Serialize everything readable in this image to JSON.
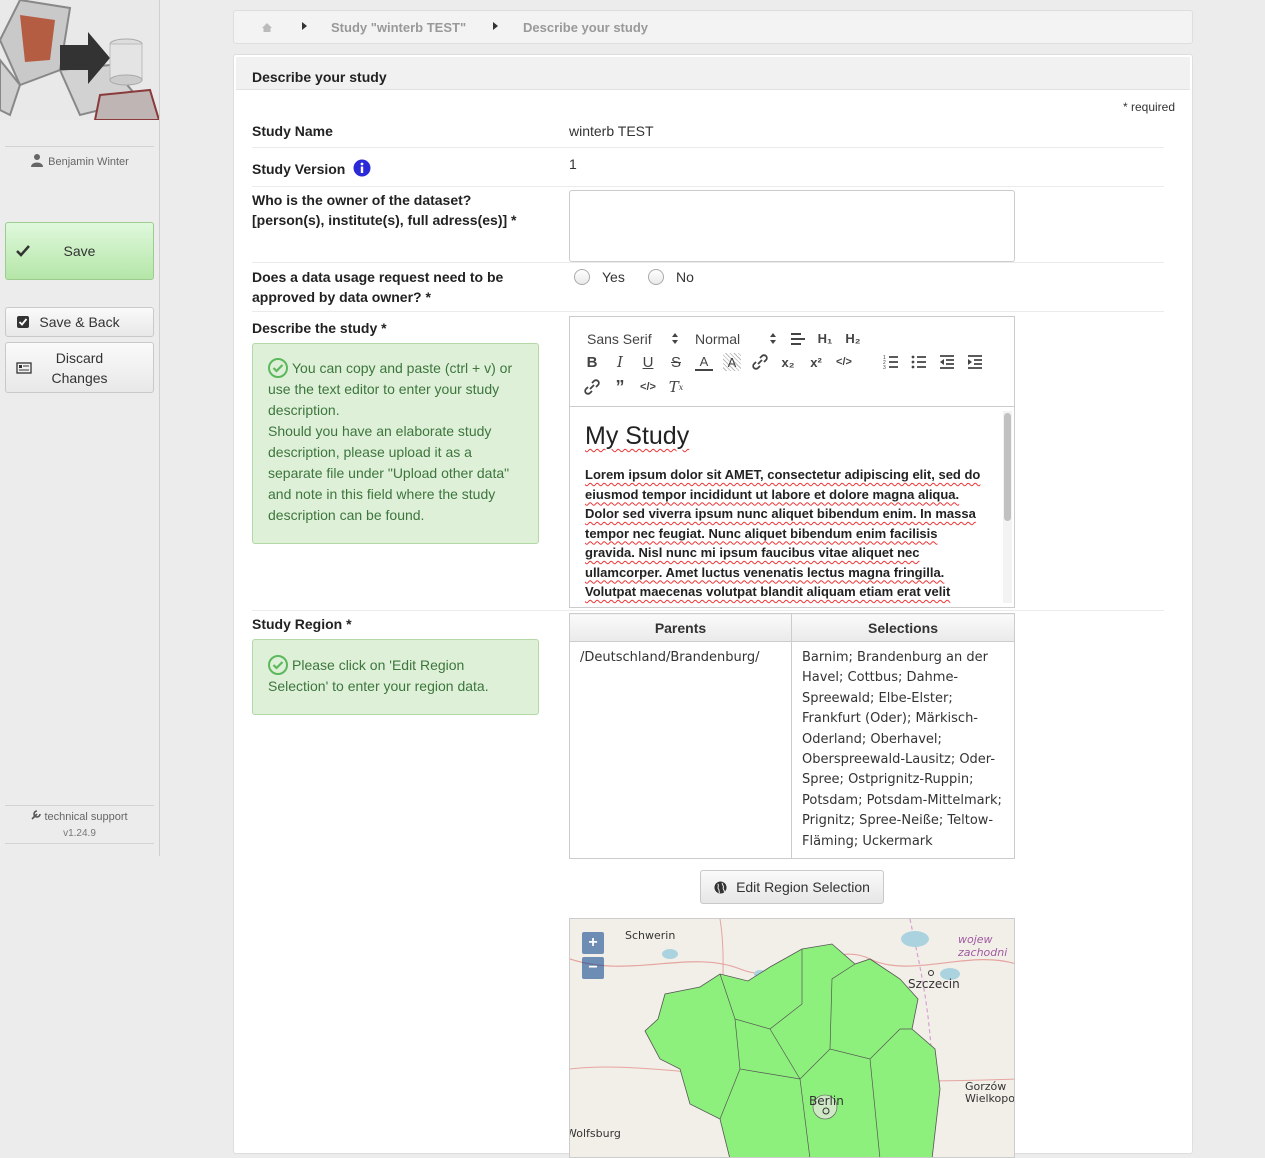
{
  "sidebar": {
    "user_name": "Benjamin Winter",
    "save_label": "Save",
    "save_back_label": "Save & Back",
    "discard_label": "Discard Changes",
    "support_label": "technical support",
    "version": "v1.24.9"
  },
  "breadcrumb": {
    "items": [
      "Study \"winterb TEST\"",
      "Describe your study"
    ]
  },
  "panel": {
    "title": "Describe your study",
    "required_note": "* required",
    "fields": {
      "study_name_label": "Study Name",
      "study_name_value": "winterb TEST",
      "study_version_label": "Study Version",
      "study_version_value": "1",
      "owner_label_line1": "Who is the owner of the dataset?",
      "owner_label_line2": "[person(s), institute(s), full adress(es)] *",
      "owner_value": "",
      "approval_label_line1": "Does a data usage request need to be",
      "approval_label_line2": "approved by data owner? *",
      "approval_options": [
        "Yes",
        "No"
      ],
      "describe_label": "Describe the study *",
      "describe_hint_line1": "You can copy and paste (ctrl + v) or use the text editor to enter your study description.",
      "describe_hint_line2": "Should you have an elaborate study description, please upload it as a separate file under \"Upload other data\" and note in this field where the study description can be found.",
      "region_label": "Study Region *",
      "region_hint": "Please click on 'Edit Region Selection' to enter your region data."
    },
    "editor": {
      "font_select": "Sans Serif",
      "size_select": "Normal",
      "content_title": "My Study",
      "content_text": "Lorem ipsum dolor sit AMET, consectetur adipiscing elit, sed do eiusmod tempor incididunt ut labore et dolore magna aliqua. Dolor sed viverra ipsum nunc aliquet bibendum enim. In massa tempor nec feugiat. Nunc aliquet bibendum enim facilisis gravida. Nisl nunc mi ipsum faucibus vitae aliquet nec ullamcorper. Amet luctus venenatis lectus magna fringilla. Volutpat maecenas volutpat blandit aliquam etiam erat velit"
    },
    "region_table": {
      "headers": [
        "Parents",
        "Selections"
      ],
      "rows": [
        {
          "parent": "/Deutschland/Brandenburg/",
          "selections": "Barnim; Brandenburg an der Havel; Cottbus; Dahme-Spreewald; Elbe-Elster; Frankfurt (Oder); Märkisch-Oderland; Oberhavel; Oberspreewald-Lausitz; Oder-Spree; Ostprignitz-Ruppin; Potsdam; Potsdam-Mittelmark; Prignitz; Spree-Neiße; Teltow-Fläming; Uckermark"
        }
      ]
    },
    "edit_region_label": "Edit Region Selection",
    "map": {
      "zoom_in": "+",
      "zoom_out": "−",
      "labels": [
        "Schwerin",
        "Szczecin",
        "Berlin",
        "Gorzów Wielkopols",
        "wojew zachodni",
        "Wolfsburg"
      ],
      "highlight_color": "#8ef07c"
    }
  },
  "colors": {
    "accent_green": "#5cb85c",
    "info_blue": "#2a2ad8"
  }
}
